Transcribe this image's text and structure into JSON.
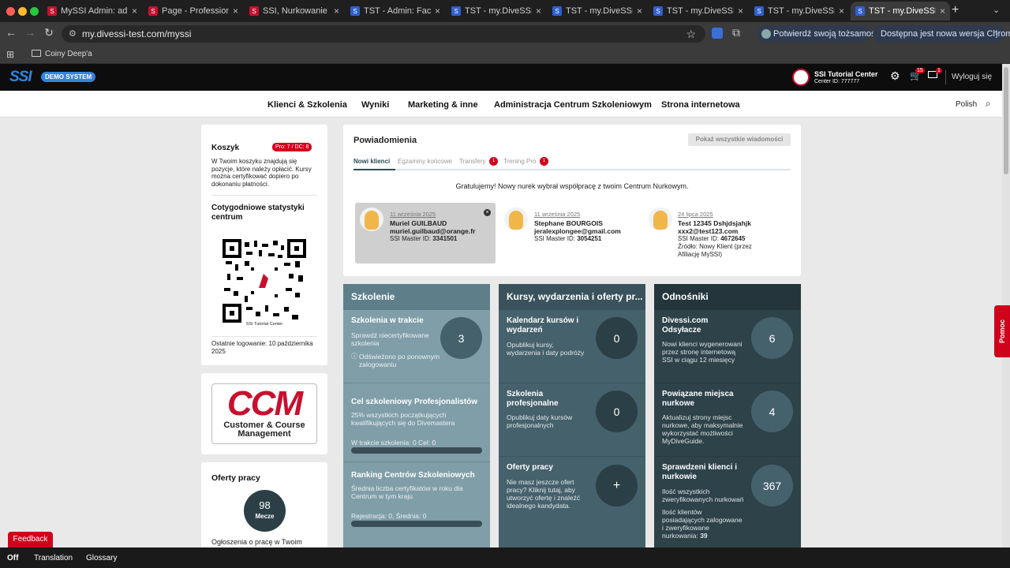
{
  "browser": {
    "tabs": [
      {
        "title": "MySSI Admin: admin",
        "fav": "red"
      },
      {
        "title": "Page - Professional P",
        "fav": "red"
      },
      {
        "title": "SSI, Nurkowanie rekr",
        "fav": "red"
      },
      {
        "title": "TST - Admin: Facilitie",
        "fav": "blue"
      },
      {
        "title": "TST - my.DiveSSI.co",
        "fav": "blue"
      },
      {
        "title": "TST - my.DiveSSI.co",
        "fav": "blue"
      },
      {
        "title": "TST - my.DiveSSI.co",
        "fav": "blue"
      },
      {
        "title": "TST - my.DiveSSI.co",
        "fav": "blue"
      },
      {
        "title": "TST - my.DiveSSI.co",
        "fav": "blue"
      }
    ],
    "url": "my.divessi-test.com/myssi",
    "verify_label": "Potwierdź swoją tożsamość",
    "update_label": "Dostępna jest nowa wersja Chrome",
    "bookmark": "Coiny Deep'a"
  },
  "header": {
    "logo": "SSI",
    "demo_badge": "DEMO SYSTEM",
    "center_name": "SSI Tutorial Center",
    "center_id": "Center ID: 777777",
    "cart_count": "15",
    "mail_count": "1",
    "logout": "Wyloguj się"
  },
  "nav": {
    "items": [
      "Klienci & Szkolenia",
      "Wyniki",
      "Marketing & inne",
      "Administracja Centrum Szkoleniowym",
      "Strona internetowa"
    ],
    "language": "Polish"
  },
  "sidebar": {
    "cart_title": "Koszyk",
    "cart_badge": "Pro: 7 / DC: 8",
    "cart_text": "W Twoim koszyku znajdują się pozycje, które należy opłacić. Kursy można certyfikować dopiero po dokonaniu płatności.",
    "stats_title": "Cotygodniowe statystyki centrum",
    "qr_caption": "SSI Tutorial Center",
    "last_login": "Ostatnie logowanie: 10 października 2025",
    "ccm_big": "CCM",
    "ccm_small1": "Customer & Course",
    "ccm_small2": "Management",
    "jobs_title": "Oferty pracy",
    "jobs_count": "98",
    "jobs_unit": "Mecze",
    "jobs_text": "Ogłoszenia o pracę w Twoim"
  },
  "notifications": {
    "title": "Powiadomienia",
    "show_all": "Pokaż wszystkie wiadomości",
    "tabs": [
      {
        "label": "Nowi klienci",
        "badge": ""
      },
      {
        "label": "Egzaminy końcowe",
        "badge": ""
      },
      {
        "label": "Transfery",
        "badge": "1"
      },
      {
        "label": "Trening Pro",
        "badge": "1"
      }
    ],
    "message": "Gratulujemy! Nowy nurek wybrał współpracę z twoim Centrum Nurkowym.",
    "clients": [
      {
        "date": "11 września 2025",
        "name": "Muriel GUILBAUD",
        "email": "muriel.guilbaud@orange.fr",
        "master_label": "SSI Master ID: ",
        "master_id": "3341501",
        "extra": ""
      },
      {
        "date": "11 września 2025",
        "name": "Stephane BOURGOIS",
        "email": "jeralexplongee@gmail.com",
        "master_label": "SSI Master ID: ",
        "master_id": "3054251",
        "extra": ""
      },
      {
        "date": "24 lipca 2025",
        "name": "Test 12345 Dshjdsjahjk",
        "email": "xxx2@test123.com",
        "master_label": "SSI Master ID: ",
        "master_id": "4672645",
        "extra": "Źródło: Nowy Klient (przez Afiliację MySSI)"
      }
    ]
  },
  "tiles": {
    "szkolenie": {
      "title": "Szkolenie",
      "items": [
        {
          "title": "Szkolenia w trakcie",
          "desc": "Sprawdź niecertyfikowane szkolenia",
          "note": "Odświeżono po ponownym zalogowaniu",
          "count": "3"
        },
        {
          "title": "Cel szkoleniowy Profesjonalistów",
          "desc": "25% wszystkich początkujących kwalifikujących się do Divemastera",
          "progress_label": "W trakcie szkolenia: 0 Cel: 0",
          "progress": 0
        },
        {
          "title": "Ranking Centrów Szkoleniowych",
          "desc": "Średnia liczba certyfikatów w roku dla Centrum w tym kraju",
          "progress_label": "Rejestracja: 0, Średnia: 0",
          "progress": 0
        }
      ]
    },
    "kursy": {
      "title": "Kursy, wydarzenia i oferty pr...",
      "items": [
        {
          "title": "Kalendarz kursów i wydarzeń",
          "desc": "Opublikuj kursy, wydarzenia i daty podróży",
          "count": "0"
        },
        {
          "title": "Szkolenia profesjonalne",
          "desc": "Opublikuj daty kursów profesjonalnych",
          "count": "0"
        },
        {
          "title": "Oferty pracy",
          "desc": "Nie masz jeszcze ofert pracy? Kliknij tutaj, aby utworzyć ofertę i znaleźć idealnego kandydata.",
          "count": "+"
        }
      ]
    },
    "odnosniki": {
      "title": "Odnośniki",
      "items": [
        {
          "title": "Divessi.com Odsyłacze",
          "desc": "Nowi klienci wygenerowani przez stronę internetową SSI w ciągu 12 miesięcy",
          "count": "6"
        },
        {
          "title": "Powiązane miejsca nurkowe",
          "desc": "Aktualizuj strony miejsc nurkowe, aby maksymalnie wykorzystać możliwości MyDiveGuide.",
          "count": "4"
        },
        {
          "title": "Sprawdzeni klienci i nurkowie",
          "desc": "Ilość wszystkich zweryfikowanych nurkowań",
          "desc2": "Ilość klientów posiadających zalogowane i zweryfikowane nurkowania: ",
          "desc2_num": "39",
          "count": "367"
        }
      ]
    }
  },
  "help_tab": "Pomoc",
  "feedback": "Feedback",
  "bottom": {
    "items": [
      "Off",
      "Translation",
      "Glossary"
    ]
  },
  "colors": {
    "accent_red": "#d0021b",
    "tile1": "#7f9ea8",
    "tile2": "#45616c",
    "tile3": "#2d4249"
  }
}
